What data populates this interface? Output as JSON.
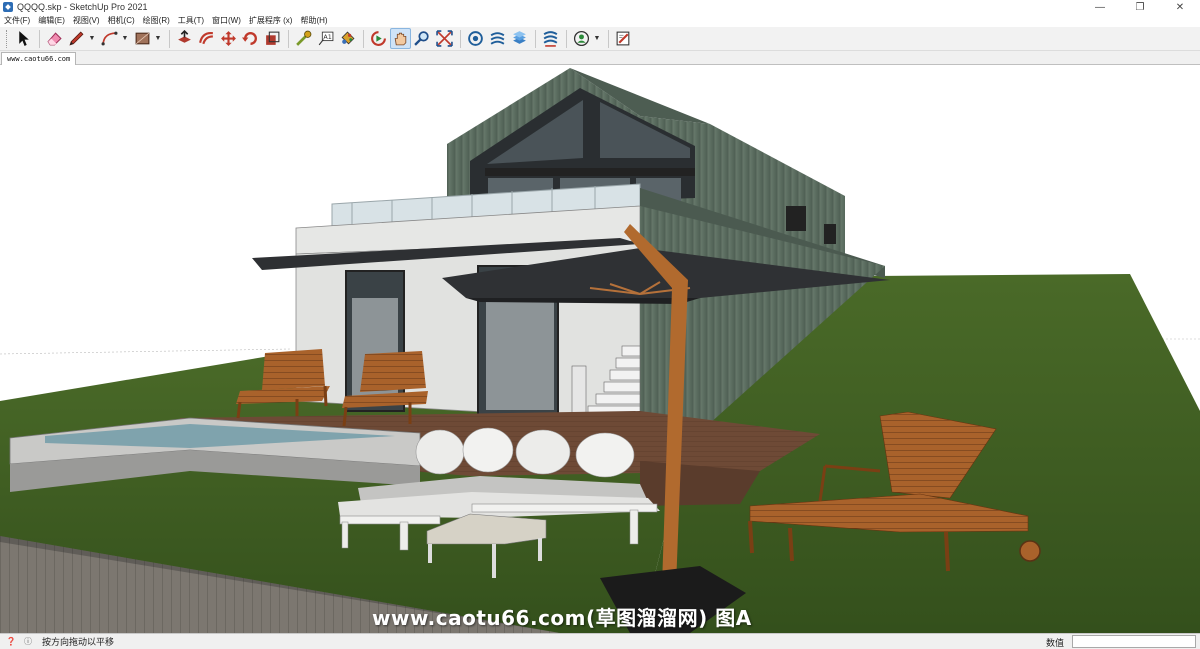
{
  "window": {
    "title": "QQQQ.skp - SketchUp Pro 2021",
    "minimize_symbol": "—",
    "maximize_symbol": "❐",
    "close_symbol": "✕"
  },
  "menu": {
    "items": [
      "文件(F)",
      "编辑(E)",
      "视图(V)",
      "相机(C)",
      "绘图(R)",
      "工具(T)",
      "窗口(W)",
      "扩展程序 (x)",
      "帮助(H)"
    ]
  },
  "toolbar": {
    "tools": [
      {
        "name": "select-tool",
        "icon": "arrow-icon"
      },
      {
        "name": "eraser-tool",
        "icon": "eraser-icon"
      },
      {
        "name": "line-tool",
        "icon": "pencil-icon",
        "caret": true
      },
      {
        "name": "arc-tool",
        "icon": "arc-icon",
        "caret": true
      },
      {
        "name": "shape-tool",
        "icon": "rectangle-icon",
        "caret": true
      },
      {
        "name": "push-pull-tool",
        "icon": "push-pull-icon"
      },
      {
        "name": "offset-tool",
        "icon": "offset-icon"
      },
      {
        "name": "move-tool",
        "icon": "move-icon"
      },
      {
        "name": "rotate-tool",
        "icon": "rotate-icon"
      },
      {
        "name": "scale-tool",
        "icon": "scale-icon"
      },
      {
        "name": "tape-measure-tool",
        "icon": "tape-measure-icon"
      },
      {
        "name": "text-tool",
        "icon": "text-icon"
      },
      {
        "name": "paint-bucket-tool",
        "icon": "paint-bucket-icon"
      },
      {
        "name": "orbit-tool",
        "icon": "orbit-icon"
      },
      {
        "name": "pan-tool",
        "icon": "hand-icon",
        "active": true
      },
      {
        "name": "zoom-tool",
        "icon": "magnifier-icon"
      },
      {
        "name": "zoom-extents-tool",
        "icon": "zoom-extents-icon"
      },
      {
        "name": "warehouse-tool",
        "icon": "warehouse-icon"
      },
      {
        "name": "extension-warehouse-tool",
        "icon": "extension-icon"
      },
      {
        "name": "layout-tool",
        "icon": "layout-icon"
      },
      {
        "name": "extension-manager-tool",
        "icon": "extension-manager-icon"
      },
      {
        "name": "account-tool",
        "icon": "account-icon",
        "caret": true
      },
      {
        "name": "send-to-layout-tool",
        "icon": "layout-send-icon"
      }
    ]
  },
  "scene_tab": {
    "label": "www.caotu66.com"
  },
  "viewport": {
    "watermark": "www.caotu66.com(草图溜溜网) 图A"
  },
  "statusbar": {
    "hint": "按方向拖动以平移",
    "measurements_label": "数值",
    "measurements_value": ""
  },
  "colors": {
    "grass": "#3f5e22",
    "sky": "#ffffff",
    "wall_white": "#e1e2e0",
    "cladding": "#5e7163",
    "umbrella": "#2f3134",
    "wood": "#a9622b",
    "pool_water": "#7fa3ad",
    "deck": "#6e4a36",
    "sofa_cushion": "#e8e8e6",
    "active_tool": "#cfe3f7"
  }
}
